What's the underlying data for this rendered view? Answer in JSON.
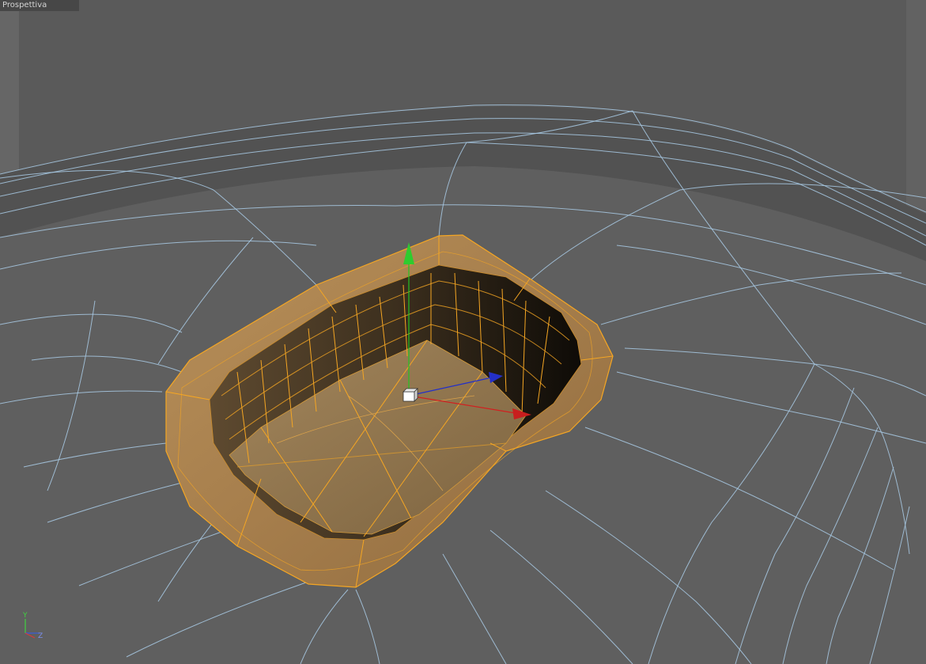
{
  "viewport": {
    "label": "Prospettiva"
  },
  "orientation_axes": {
    "y": "Y",
    "z": "Z"
  },
  "colors": {
    "background": "#5b5b5b",
    "wire": "#a9cbe6",
    "selection_edge": "#f5a623",
    "gizmo_y": "#22c422",
    "gizmo_x": "#d21f1f",
    "gizmo_z": "#2430c8"
  },
  "icons": {
    "object_axis": "cube-icon",
    "orientation": "world-axes-icon"
  }
}
